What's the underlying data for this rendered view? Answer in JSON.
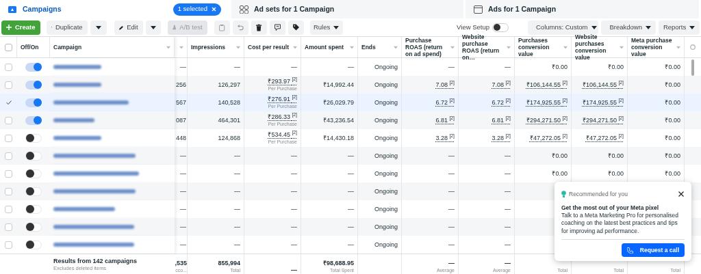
{
  "tabs": [
    {
      "label": "Campaigns",
      "selected": true,
      "badge": "1 selected"
    },
    {
      "label": "Ad sets for 1 Campaign",
      "selected": false
    },
    {
      "label": "Ads for 1 Campaign",
      "selected": false
    }
  ],
  "toolbar": {
    "create": "Create",
    "duplicate": "Duplicate",
    "edit": "Edit",
    "ab_test": {
      "label": "A/B test",
      "disabled": true
    },
    "rules": "Rules",
    "view_setup": {
      "label": "View Setup",
      "on": false
    },
    "columns": "Columns: Custom",
    "breakdown": "Breakdown",
    "reports": "Reports"
  },
  "table": {
    "select_all": {
      "checked": false
    },
    "columns": [
      {
        "label": "Off/On"
      },
      {
        "label": "Campaign"
      },
      {
        "kind": "cut"
      },
      {
        "label": "Impressions"
      },
      {
        "label": "Cost per result"
      },
      {
        "label": "Amount spent"
      },
      {
        "label": "Ends"
      },
      {
        "label": "Purchase ROAS (return on ad spend)"
      },
      {
        "label": "Website purchase ROAS (return on…"
      },
      {
        "label": "Purchases conversion value"
      },
      {
        "label": "Website purchases conversion value"
      },
      {
        "label": "Meta purchase conversion value"
      }
    ],
    "rows": [
      {
        "selected": false,
        "on": true,
        "cells": [
          "—",
          "—",
          "—",
          "—",
          "Ongoing",
          "—",
          "—",
          "₹0.00",
          "₹0.00",
          "₹0.00"
        ]
      },
      {
        "selected": false,
        "on": true,
        "cells": [
          "256",
          "126,297",
          {
            "text": "₹293.97 $^{[2]}$",
            "link": true,
            "sub": "Per Purchase"
          },
          "₹14,992.44",
          "Ongoing",
          {
            "text": "7.08 $^{[2]}$",
            "link": true
          },
          {
            "text": "7.08 $^{[2]}$",
            "link": true
          },
          {
            "text": "₹106,144.55 $^{[2]}$",
            "link": true
          },
          {
            "text": "₹106,144.55 $^{[2]}$",
            "link": true
          },
          "₹0.00"
        ]
      },
      {
        "selected": true,
        "on": true,
        "cells": [
          "567",
          "140,528",
          {
            "text": "₹276.91 $^{[2]}$",
            "link": true,
            "sub": "Per Purchase"
          },
          "₹26,029.79",
          "Ongoing",
          {
            "text": "6.72 $^{[2]}$",
            "link": true
          },
          {
            "text": "6.72 $^{[2]}$",
            "link": true
          },
          {
            "text": "₹174,925.55 $^{[2]}$",
            "link": true
          },
          {
            "text": "₹174,925.55 $^{[2]}$",
            "link": true
          },
          "₹0.00"
        ]
      },
      {
        "selected": false,
        "on": true,
        "cells": [
          "087",
          "464,301",
          {
            "text": "₹286.33 $^{[2]}$",
            "link": true,
            "sub": "Per Purchase"
          },
          "₹43,236.54",
          "Ongoing",
          {
            "text": "6.81 $^{[2]}$",
            "link": true
          },
          {
            "text": "6.81 $^{[2]}$",
            "link": true
          },
          {
            "text": "₹294,271.50 $^{[2]}$",
            "link": true
          },
          {
            "text": "₹294,271.50 $^{[2]}$",
            "link": true
          },
          "₹0.00"
        ]
      },
      {
        "selected": false,
        "on": false,
        "cells": [
          "448",
          "124,868",
          {
            "text": "₹534.45 $^{[2]}$",
            "link": true,
            "sub": "Per Purchase"
          },
          "₹14,430.18",
          "Ongoing",
          {
            "text": "3.28 $^{[2]}$",
            "link": true
          },
          {
            "text": "3.28 $^{[2]}$",
            "link": true
          },
          {
            "text": "₹47,272.05 $^{[2]}$",
            "link": true
          },
          {
            "text": "₹47,272.05 $^{[2]}$",
            "link": true
          },
          "₹0.00"
        ]
      },
      {
        "selected": false,
        "on": false,
        "cells": [
          "—",
          "—",
          "—",
          "—",
          "Ongoing",
          "—",
          "—",
          "₹0.00",
          "₹0.00",
          "₹0.00"
        ]
      },
      {
        "selected": false,
        "on": false,
        "cells": [
          "—",
          "—",
          "—",
          "—",
          "Ongoing",
          "—",
          "—",
          "₹0.00",
          "₹0.00",
          "₹0.00"
        ]
      },
      {
        "selected": false,
        "on": false,
        "cells": [
          "—",
          "—",
          "—",
          "—",
          "Ongoing",
          "—",
          "—"
        ]
      },
      {
        "selected": false,
        "on": false,
        "cells": [
          "—",
          "—",
          "—",
          "—",
          "Ongoing",
          "—",
          "—"
        ]
      },
      {
        "selected": false,
        "on": false,
        "cells": [
          "—",
          "—",
          "—",
          "—",
          "Ongoing",
          "—",
          "—"
        ]
      },
      {
        "selected": false,
        "on": false,
        "cells": [
          "—",
          "—",
          "—",
          "—",
          "Ongoing",
          "—",
          "—"
        ]
      }
    ],
    "footer": {
      "label": "Results from 142 campaigns",
      "sub": "Excludes deleted items",
      "cells": [
        {
          "text": ",535",
          "sub": "cco..."
        },
        {
          "text": "855,994",
          "sub": "Total"
        },
        {
          "text": "—"
        },
        {
          "text": "₹98,688.95",
          "sub": "Total Spent"
        },
        {},
        {
          "text": "—",
          "sub": "Average"
        },
        {
          "text": "—",
          "sub": "Average"
        },
        {
          "sub": "Total"
        },
        {
          "sub": "Total"
        },
        {
          "sub": "Total"
        }
      ]
    }
  },
  "popup": {
    "eyebrow": "Recommended for you",
    "title": "Get the most out of your Meta pixel",
    "body": "Talk to a Meta Marketing Pro for personalised coaching on the latest best practices and tips for improving ad performance.",
    "button": "Request a call"
  }
}
